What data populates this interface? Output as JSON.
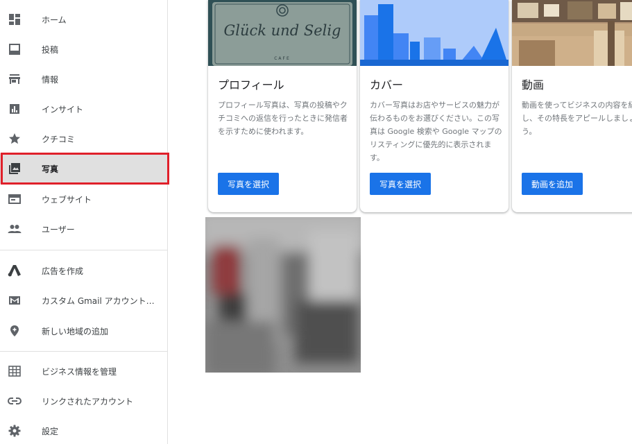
{
  "sidebar": {
    "items": [
      {
        "label": "ホーム",
        "icon": "dashboard-icon"
      },
      {
        "label": "投稿",
        "icon": "post-icon"
      },
      {
        "label": "情報",
        "icon": "store-icon"
      },
      {
        "label": "インサイト",
        "icon": "insights-icon"
      },
      {
        "label": "クチコミ",
        "icon": "star-icon"
      },
      {
        "label": "写真",
        "icon": "photo-library-icon",
        "active": true
      },
      {
        "label": "ウェブサイト",
        "icon": "website-icon"
      },
      {
        "label": "ユーザー",
        "icon": "people-icon"
      },
      {
        "label": "広告を作成",
        "icon": "google-ads-icon"
      },
      {
        "label": "カスタム Gmail アカウント…",
        "icon": "mail-icon"
      },
      {
        "label": "新しい地域の追加",
        "icon": "location-pin-icon"
      },
      {
        "label": "ビジネス情報を管理",
        "icon": "business-grid-icon"
      },
      {
        "label": "リンクされたアカウント",
        "icon": "link-icon"
      },
      {
        "label": "設定",
        "icon": "gear-icon"
      }
    ]
  },
  "cards": [
    {
      "title": "プロフィール",
      "description": "プロフィール写真は、写真の投稿やクチコミへの返信を行ったときに発信者を示すために使われます。",
      "button": "写真を選択",
      "image_text": "Glück und Selig",
      "image_subtext": "CAFE"
    },
    {
      "title": "カバー",
      "description": "カバー写真はお店やサービスの魅力が伝わるものをお選びください。この写真は Google 検索や Google マップのリスティングに優先的に表示されます。",
      "button": "写真を選択"
    },
    {
      "title": "動画",
      "description": "動画を使ってビジネスの内容を紹介し、その特長をアピールしましょう。",
      "button": "動画を追加"
    }
  ],
  "colors": {
    "accent": "#1a73e8",
    "highlight": "#e0202a",
    "active_bg": "#e0e0e0"
  }
}
